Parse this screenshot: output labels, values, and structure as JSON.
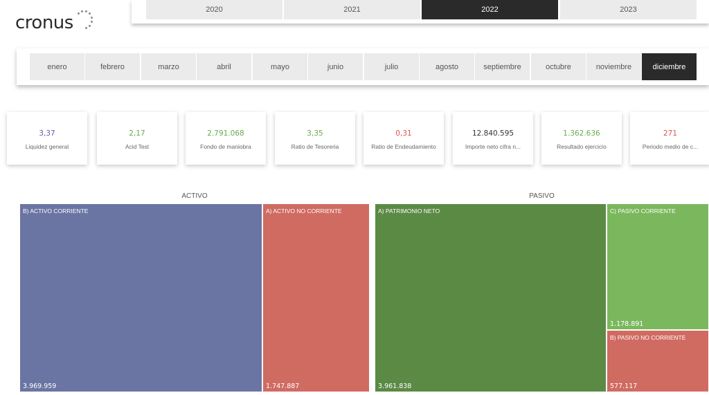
{
  "brand": {
    "name": "cronus"
  },
  "years": [
    {
      "label": "2020",
      "selected": false
    },
    {
      "label": "2021",
      "selected": false
    },
    {
      "label": "2022",
      "selected": true
    },
    {
      "label": "2023",
      "selected": false
    }
  ],
  "months": [
    {
      "label": "enero",
      "selected": false
    },
    {
      "label": "febrero",
      "selected": false
    },
    {
      "label": "marzo",
      "selected": false
    },
    {
      "label": "abril",
      "selected": false
    },
    {
      "label": "mayo",
      "selected": false
    },
    {
      "label": "junio",
      "selected": false
    },
    {
      "label": "julio",
      "selected": false
    },
    {
      "label": "agosto",
      "selected": false
    },
    {
      "label": "septiembre",
      "selected": false
    },
    {
      "label": "octubre",
      "selected": false
    },
    {
      "label": "noviembre",
      "selected": false
    },
    {
      "label": "diciembre",
      "selected": true
    }
  ],
  "kpis": [
    {
      "value": "3,37",
      "label": "Liquidez general",
      "color": "#5b5fa8"
    },
    {
      "value": "2,17",
      "label": "Acid Test",
      "color": "#6aa84f"
    },
    {
      "value": "2.791.068",
      "label": "Fondo de maniobra",
      "color": "#6aa84f"
    },
    {
      "value": "3,35",
      "label": "Ratio de Tesoreria",
      "color": "#6aa84f"
    },
    {
      "value": "0,31",
      "label": "Ratio de Endeudamiento",
      "color": "#e05252"
    },
    {
      "value": "12.840.595",
      "label": "Importe neto cifra n...",
      "color": "#333333"
    },
    {
      "value": "1.362.636",
      "label": "Resultado ejercicio",
      "color": "#6aa84f"
    },
    {
      "value": "271",
      "label": "Periodo medio de c...",
      "color": "#e05252"
    }
  ],
  "chart_data": [
    {
      "type": "treemap",
      "title": "ACTIVO",
      "items": [
        {
          "label": "B) ACTIVO CORRIENTE",
          "value": 3969959,
          "display": "3.969.959",
          "color": "#6b75a3"
        },
        {
          "label": "A) ACTIVO NO CORRIENTE",
          "value": 1747887,
          "display": "1.747.887",
          "color": "#d06b62"
        }
      ]
    },
    {
      "type": "treemap",
      "title": "PASIVO",
      "items": [
        {
          "label": "A) PATRIMONIO NETO",
          "value": 3961838,
          "display": "3.961.838",
          "color": "#5b8a45"
        },
        {
          "label": "C) PASIVO CORRIENTE",
          "value": 1178891,
          "display": "1.178.891",
          "color": "#7bb85d"
        },
        {
          "label": "B) PASIVO NO CORRIENTE",
          "value": 577117,
          "display": "577.117",
          "color": "#d06b62"
        }
      ]
    }
  ]
}
